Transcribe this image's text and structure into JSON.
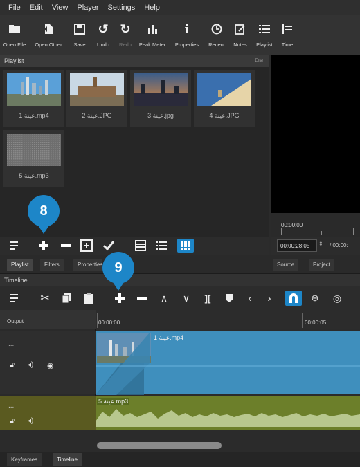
{
  "menu": [
    "File",
    "Edit",
    "View",
    "Player",
    "Settings",
    "Help"
  ],
  "toolbar": [
    {
      "label": "Open File",
      "icon": "folder-icon"
    },
    {
      "label": "Open Other",
      "icon": "open-other-icon"
    },
    {
      "label": "Save",
      "icon": "save-icon"
    },
    {
      "label": "Undo",
      "icon": "undo-icon"
    },
    {
      "label": "Redo",
      "icon": "redo-icon"
    },
    {
      "label": "Peak Meter",
      "icon": "peak-meter-icon"
    },
    {
      "label": "Properties",
      "icon": "info-icon"
    },
    {
      "label": "Recent",
      "icon": "clock-icon"
    },
    {
      "label": "Notes",
      "icon": "notes-icon"
    },
    {
      "label": "Playlist",
      "icon": "list-icon"
    },
    {
      "label": "Time",
      "icon": "timeline-icon"
    }
  ],
  "playlist": {
    "title": "Playlist",
    "items": [
      {
        "caption": "1 عينة.mp4"
      },
      {
        "caption": "2 عينة.JPG"
      },
      {
        "caption": "3 عينة.jpg"
      },
      {
        "caption": "4 عينة.JPG"
      },
      {
        "caption": "5 عينة.mp3"
      }
    ]
  },
  "viewer": {
    "ruler_timecode": "00:00:00",
    "position": "00:00:28:05",
    "duration": "/ 00:00:"
  },
  "panel_tabs": [
    "Playlist",
    "Filters",
    "Properties"
  ],
  "viewer_tabs": [
    "Source",
    "Project"
  ],
  "timeline": {
    "title": "Timeline",
    "output_label": "Output",
    "ruler": [
      "00:00:00",
      "00:00:05"
    ],
    "video_clip": "عينة 1.mp4",
    "audio_clip": "عينة 5.mp3"
  },
  "bottom_tabs": [
    "Keyframes",
    "Timeline"
  ],
  "callouts": [
    "8",
    "9"
  ],
  "colors": {
    "accent": "#1d86c8",
    "video_track": "#3f8fbd",
    "audio_track": "#6c7f2a"
  }
}
